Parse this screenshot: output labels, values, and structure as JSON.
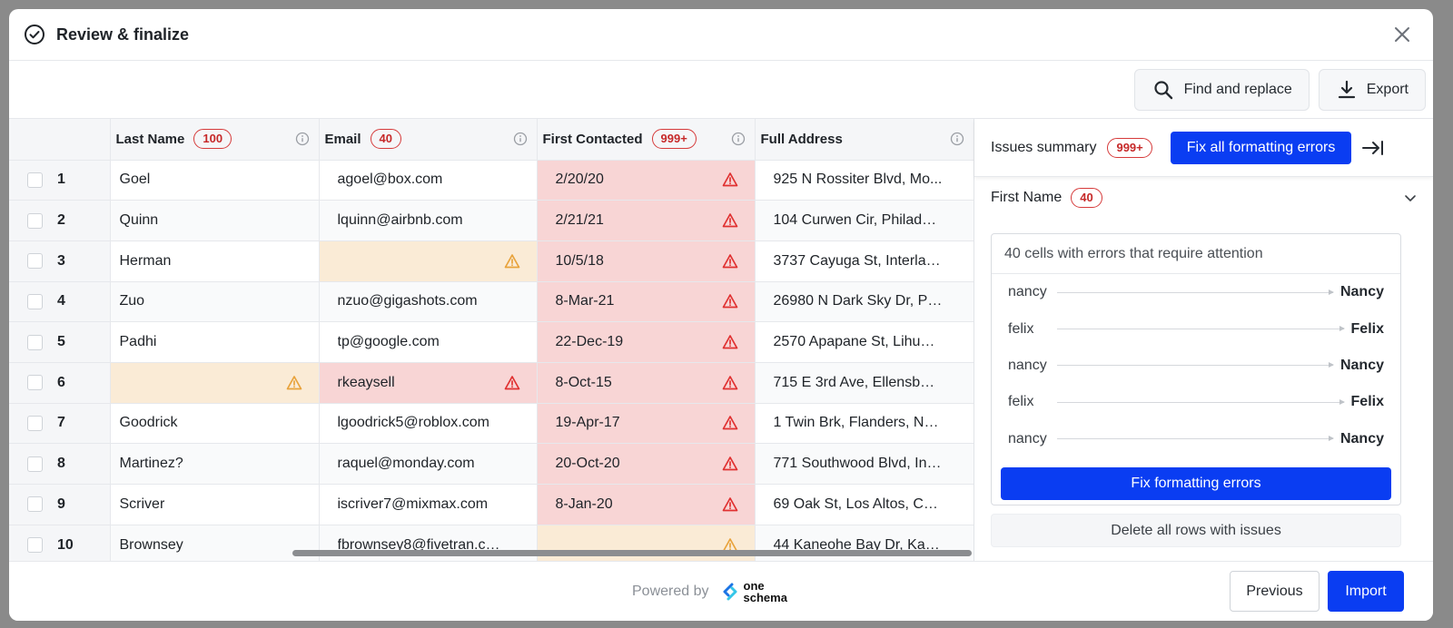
{
  "window": {
    "title": "Review & finalize"
  },
  "toolbar": {
    "find_replace_label": "Find and replace",
    "export_label": "Export"
  },
  "columns": [
    {
      "name": "Last Name",
      "badge": "100"
    },
    {
      "name": "Email",
      "badge": "40"
    },
    {
      "name": "First Contacted",
      "badge": "999+"
    },
    {
      "name": "Full Address",
      "badge": ""
    }
  ],
  "rows": [
    {
      "index": "1",
      "last_name": "Goel",
      "email": "agoel@box.com",
      "first_contacted": "2/20/20",
      "full_address": "925 N Rossiter Blvd, Mo..."
    },
    {
      "index": "2",
      "last_name": "Quinn",
      "email": "lquinn@airbnb.com",
      "first_contacted": "2/21/21",
      "full_address": "104 Curwen Cir, Philadel..."
    },
    {
      "index": "3",
      "last_name": "Herman",
      "email": "",
      "first_contacted": "10/5/18",
      "full_address": "3737 Cayuga St, Interlak..."
    },
    {
      "index": "4",
      "last_name": "Zuo",
      "email": "nzuo@gigashots.com",
      "first_contacted": "8-Mar-21",
      "full_address": "26980 N Dark Sky Dr, Pa..."
    },
    {
      "index": "5",
      "last_name": "Padhi",
      "email": "tp@google.com",
      "first_contacted": "22-Dec-19",
      "full_address": "2570 Apapane St, Lihue,..."
    },
    {
      "index": "6",
      "last_name": "",
      "email": "rkeaysell",
      "first_contacted": "8-Oct-15",
      "full_address": "715 E 3rd Ave, Ellensbur..."
    },
    {
      "index": "7",
      "last_name": "Goodrick",
      "email": "lgoodrick5@roblox.com",
      "first_contacted": "19-Apr-17",
      "full_address": "1 Twin Brk, Flanders, NJ,..."
    },
    {
      "index": "8",
      "last_name": "Martinez?",
      "email": "raquel@monday.com",
      "first_contacted": "20-Oct-20",
      "full_address": "771 Southwood Blvd, Inc..."
    },
    {
      "index": "9",
      "last_name": "Scriver",
      "email": "iscriver7@mixmax.com",
      "first_contacted": "8-Jan-20",
      "full_address": "69 Oak St, Los Altos, CA,..."
    },
    {
      "index": "10",
      "last_name": "Brownsey",
      "email": "fbrownsey8@fivetran.com",
      "first_contacted": "",
      "full_address": "44 Kaneohe Bay Dr, Kan..."
    }
  ],
  "issues": {
    "summary_label": "Issues summary",
    "summary_badge": "999+",
    "fix_all_label": "Fix all formatting errors",
    "section_label": "First Name",
    "section_badge": "40",
    "card_title": "40 cells with errors that require attention",
    "fixes": [
      {
        "from": "nancy",
        "to": "Nancy"
      },
      {
        "from": "felix",
        "to": "Felix"
      },
      {
        "from": "nancy",
        "to": "Nancy"
      },
      {
        "from": "felix",
        "to": "Felix"
      },
      {
        "from": "nancy",
        "to": "Nancy"
      }
    ],
    "fix_label": "Fix formatting errors",
    "delete_label": "Delete all rows with issues"
  },
  "footer": {
    "powered_by": "Powered by",
    "brand_line1": "one",
    "brand_line2": "schema",
    "previous_label": "Previous",
    "import_label": "Import"
  },
  "colors": {
    "accent": "#0a3df2",
    "error_bg": "#f8d5d5",
    "warning_bg": "#faebd6",
    "error_icon": "#e03131",
    "warning_icon": "#e8a33c"
  },
  "icons": [
    "check-circle-icon",
    "close-icon",
    "search-icon",
    "download-icon",
    "info-icon",
    "error-triangle-icon",
    "warning-triangle-icon",
    "collapse-panel-icon",
    "chevron-down-icon",
    "oneschema-logo-icon"
  ]
}
